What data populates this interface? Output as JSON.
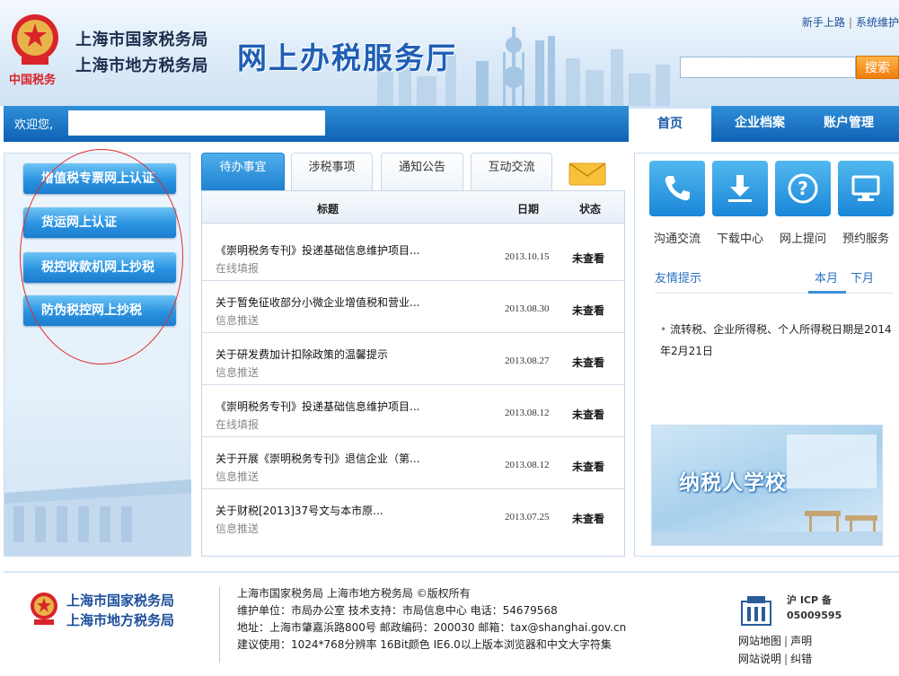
{
  "header": {
    "bureau_names": [
      "上海市国家税务局",
      "上海市地方税务局"
    ],
    "hall_title": "网上办税服务厅",
    "emblem_caption": "中国税务",
    "top_links": [
      "新手上路",
      "系统维护"
    ],
    "search_value": "",
    "search_button": "搜索"
  },
  "navbar": {
    "welcome": "欢迎您,",
    "tabs": [
      {
        "label": "首页",
        "active": true
      },
      {
        "label": "企业档案",
        "active": false
      },
      {
        "label": "账户管理",
        "active": false
      }
    ]
  },
  "left_menu": {
    "items": [
      "增值税专票网上认证",
      "货运网上认证",
      "税控收款机网上抄税",
      "防伪税控网上抄税"
    ]
  },
  "tasks": {
    "tabs": [
      {
        "label": "待办事宜",
        "active": true
      },
      {
        "label": "涉税事项",
        "active": false
      },
      {
        "label": "通知公告",
        "active": false
      },
      {
        "label": "互动交流",
        "active": false
      }
    ],
    "mail_icon": "mail-icon",
    "columns": [
      "标题",
      "日期",
      "状态"
    ],
    "rows": [
      {
        "title": "《崇明税务专刊》投递基础信息维护项目...",
        "category": "在线填报",
        "date": "2013.10.15",
        "status": "未查看"
      },
      {
        "title": "关于暂免征收部分小微企业增值税和营业...",
        "category": "信息推送",
        "date": "2013.08.30",
        "status": "未查看"
      },
      {
        "title": "关于研发费加计扣除政策的温馨提示",
        "category": "信息推送",
        "date": "2013.08.27",
        "status": "未查看"
      },
      {
        "title": "《崇明税务专刊》投递基础信息维护项目...",
        "category": "在线填报",
        "date": "2013.08.12",
        "status": "未查看"
      },
      {
        "title": "关于开展《崇明税务专刊》退信企业（第...",
        "category": "信息推送",
        "date": "2013.08.12",
        "status": "未查看"
      },
      {
        "title": "关于财税[2013]37号文与本市原...",
        "category": "信息推送",
        "date": "2013.07.25",
        "status": "未查看"
      }
    ]
  },
  "services": {
    "items": [
      {
        "label": "沟通交流",
        "icon": "phone-icon"
      },
      {
        "label": "下载中心",
        "icon": "download-icon"
      },
      {
        "label": "网上提问",
        "icon": "question-icon"
      },
      {
        "label": "预约服务",
        "icon": "monitor-icon"
      }
    ],
    "tips_title": "友情提示",
    "month_tabs": [
      {
        "label": "本月",
        "active": true
      },
      {
        "label": "下月",
        "active": false
      }
    ],
    "tip": "流转税、企业所得税、个人所得税日期是2014年2月21日",
    "school_banner": "纳税人学校"
  },
  "footer": {
    "bureau_names": [
      "上海市国家税务局",
      "上海市地方税务局"
    ],
    "info_lines": [
      "上海市国家税务局  上海市地方税务局  ©版权所有",
      "维护单位：市局办公室   技术支持：市局信息中心  电话：54679568",
      "地址：上海市肇嘉浜路800号    邮政编码：200030    邮箱：tax@shanghai.gov.cn",
      "建议使用：1024*768分辨率  16Bit颜色  IE6.0以上版本浏览器和中文大字符集"
    ],
    "icp_lines": [
      "沪 ICP 备",
      "05009595"
    ],
    "links": [
      "网站地图",
      "声明",
      "网站说明",
      "纠错"
    ]
  },
  "colors": {
    "nav_blue": "#0f62b5",
    "button_blue": "#2a93e2",
    "search_orange": "#f07d0c",
    "annotation_red": "#e12a2a"
  }
}
